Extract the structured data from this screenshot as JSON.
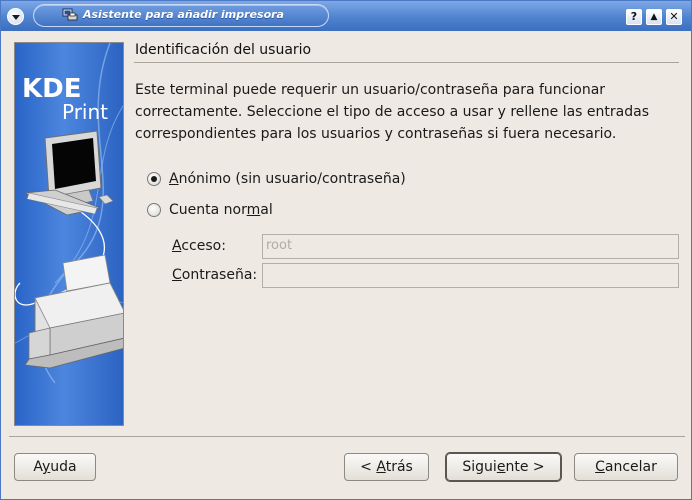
{
  "window": {
    "title": "Asistente para añadir impresora",
    "buttons": {
      "help": "?",
      "shade": "▲",
      "close": "✕"
    }
  },
  "banner": {
    "logo_top": "KDE",
    "logo_bottom": "Print"
  },
  "page": {
    "heading": "Identificación del usuario",
    "description": "Este terminal puede requerir un usuario/contraseña para funcionar correctamente. Seleccione el tipo de acceso a usar y rellene las entradas correspondientes para los usuarios y contraseñas si fuera necesario."
  },
  "options": [
    {
      "pre": "",
      "mnemonic": "A",
      "post": "nónimo (sin usuario/contraseña)",
      "checked": true
    },
    {
      "pre": "Cuenta nor",
      "mnemonic": "m",
      "post": "al",
      "checked": false
    }
  ],
  "fields": {
    "access": {
      "mnemonic": "A",
      "label_rest": "cceso:",
      "value": "root"
    },
    "password": {
      "mnemonic": "C",
      "label_rest": "ontraseña:",
      "value": ""
    }
  },
  "buttons": {
    "help": {
      "mnemonic": "y",
      "pre": "A",
      "post": "uda"
    },
    "back": {
      "pre": "< ",
      "mnemonic": "A",
      "post": "trás"
    },
    "next": {
      "pre": "Sigui",
      "mnemonic": "e",
      "post": "nte >"
    },
    "cancel": {
      "pre": "",
      "mnemonic": "C",
      "post": "ancelar"
    }
  },
  "colors": {
    "titlebar": "#4f83cf",
    "banner": "#2a64c6",
    "background": "#eeeae3"
  }
}
